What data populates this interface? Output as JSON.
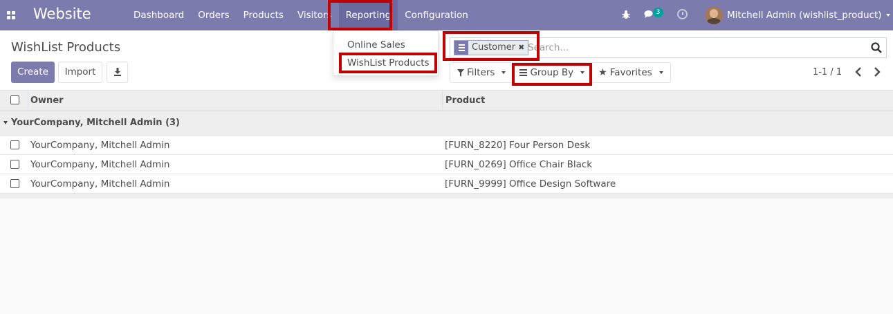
{
  "navbar": {
    "app_name": "Website",
    "menu": [
      "Dashboard",
      "Orders",
      "Products",
      "Visitors",
      "Reporting",
      "Configuration"
    ],
    "chat_count": "3",
    "user_name": "Mitchell Admin (wishlist_product)"
  },
  "reporting_menu": {
    "items": [
      "Online Sales",
      "WishList Products"
    ]
  },
  "control_panel": {
    "title": "WishList Products",
    "create_label": "Create",
    "import_label": "Import",
    "search": {
      "facet_label": "Customer",
      "facet_remove": "✖",
      "placeholder": "Search..."
    },
    "filters_label": "Filters",
    "group_by_label": "Group By",
    "favorites_label": "Favorites",
    "pager": "1-1 / 1"
  },
  "table": {
    "columns": [
      "Owner",
      "Product"
    ],
    "group": {
      "label": "YourCompany, Mitchell Admin (3)"
    },
    "rows": [
      {
        "owner": "YourCompany, Mitchell Admin",
        "product": "[FURN_8220] Four Person Desk"
      },
      {
        "owner": "YourCompany, Mitchell Admin",
        "product": "[FURN_0269] Office Chair Black"
      },
      {
        "owner": "YourCompany, Mitchell Admin",
        "product": "[FURN_9999] Office Design Software"
      }
    ]
  },
  "colors": {
    "brand": "#7c7bad",
    "highlight": "#c00000"
  }
}
